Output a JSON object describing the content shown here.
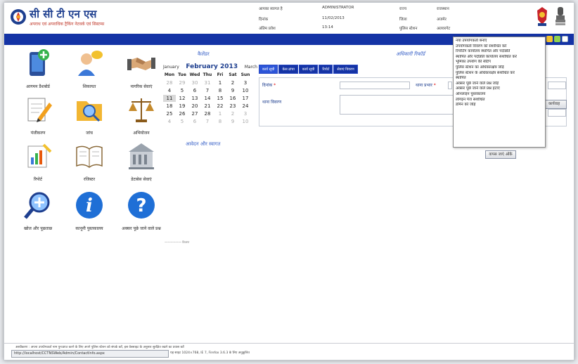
{
  "header": {
    "brand_title": "सी सी टी एन एस",
    "brand_subtitle": "अपराध एवं अपराधिक ट्रैकिंग नेटवर्क एवं सिस्टम्स",
    "info": [
      {
        "label": "आपका स्वागत है",
        "value": "ADMINISTRATOR"
      },
      {
        "label": "दिनांक",
        "value": "11/02/2013"
      },
      {
        "label": "अंतिम प्रवेश",
        "value": "13:14"
      },
      {
        "label": "राज्य",
        "value": "राजस्थान"
      },
      {
        "label": "जिला",
        "value": "अजमेर"
      },
      {
        "label": "पुलिस स्टेशन",
        "value": "अलवरगेट"
      }
    ]
  },
  "apps": [
    {
      "name": "आगमन डैशबोर्ड",
      "icon": "phone-add-icon"
    },
    {
      "name": "शिकायत",
      "icon": "user-message-icon"
    },
    {
      "name": "नागरिक सेवाएं",
      "icon": "handshake-icon"
    },
    {
      "name": "पंजीकरण",
      "icon": "edit-document-icon"
    },
    {
      "name": "जांच",
      "icon": "folder-search-icon"
    },
    {
      "name": "अभियोजन",
      "icon": "scales-icon"
    },
    {
      "name": "रिपोर्ट",
      "icon": "report-chart-icon"
    },
    {
      "name": "रजिस्टर",
      "icon": "open-book-icon"
    },
    {
      "name": "डेटाबेस सेवाएं",
      "icon": "building-icon"
    },
    {
      "name": "खोज और पूछताछ",
      "icon": "search-add-icon"
    },
    {
      "name": "कानूनी पुस्तकालय",
      "icon": "info-icon"
    },
    {
      "name": "अक्सर पूछे जाने वाले प्रश्न",
      "icon": "help-icon"
    }
  ],
  "calendar": {
    "title": "कैलेंडर",
    "prev_month": "January",
    "month_year": "February 2013",
    "next_month": "March",
    "weekdays": [
      "Mon",
      "Tue",
      "Wed",
      "Thu",
      "Fri",
      "Sat",
      "Sun"
    ],
    "days": [
      [
        "28",
        "29",
        "30",
        "31",
        "1",
        "2",
        "3"
      ],
      [
        "4",
        "5",
        "6",
        "7",
        "8",
        "9",
        "10"
      ],
      [
        "11",
        "12",
        "13",
        "14",
        "15",
        "16",
        "17"
      ],
      [
        "18",
        "19",
        "20",
        "21",
        "22",
        "23",
        "24"
      ],
      [
        "25",
        "26",
        "27",
        "28",
        "1",
        "2",
        "3"
      ],
      [
        "4",
        "5",
        "6",
        "7",
        "8",
        "9",
        "10"
      ]
    ],
    "today": "11",
    "footer_link": "आवेदन और स्वागत",
    "note": "—————— विवरण"
  },
  "records": {
    "title": "अधिकारी रिकॉर्ड",
    "tabs": [
      "कार्य सूची",
      "केस ढांचा",
      "कार्य सूची",
      "रिपोर्ट",
      "सेवाएं विवरण"
    ],
    "form": {
      "date_label": "दिनांक",
      "station_label": "थाना प्रभार",
      "remarks_label": "थाना विवरण",
      "search_button": "कार्यवाह"
    }
  },
  "menu": {
    "items": [
      "नया उपयोगकर्ता बनाएं",
      "उपयोगकर्ता विवरण को संशोधित करें",
      "रिपोर्टिंग कार्यालय स्थापित और पदोन्नति",
      "स्थापित और पदोन्नति कार्यालय संशोधित करें",
      "भूमिका उपयोग की सेटिंग",
      "पुलिस स्टेशन का अधिकारक्षेत्र जोड़ें",
      "पुलिस स्टेशन के अधिकारक्षेत्र संशोधित करें",
      "स्थापित",
      "अक्सर पूछे जाने वाले प्रश्न जोड़ें",
      "अक्सर पूछे जाने वाले प्रश्न हटाएं",
      "ऑनलाइन पुस्तकालय",
      "लॉगइन पेज संशोधित",
      "डोमेन को जोड़ें"
    ],
    "button": "वापस जाएं ओके"
  },
  "footer": {
    "notice": "अस्वीकरण : अपना उपयोगकर्ता नाम पुनःप्राप्त करने के लिए अपने पुलिस स्टेशन को संपर्क करें, इस वेबसाइट के अनुसार सुरक्षित रखने का प्रयास करें",
    "resolution": "यह साइट 1024×768, IE 7, Firefox 3.6.3 के लिए अनुकूलित",
    "status_url": "http://localhost/CCTNSWeb/Admin/ContactInfo.aspx"
  },
  "colors": {
    "nav": "#1433a5",
    "brand": "#1e3f8f",
    "link": "#3a62c8"
  }
}
